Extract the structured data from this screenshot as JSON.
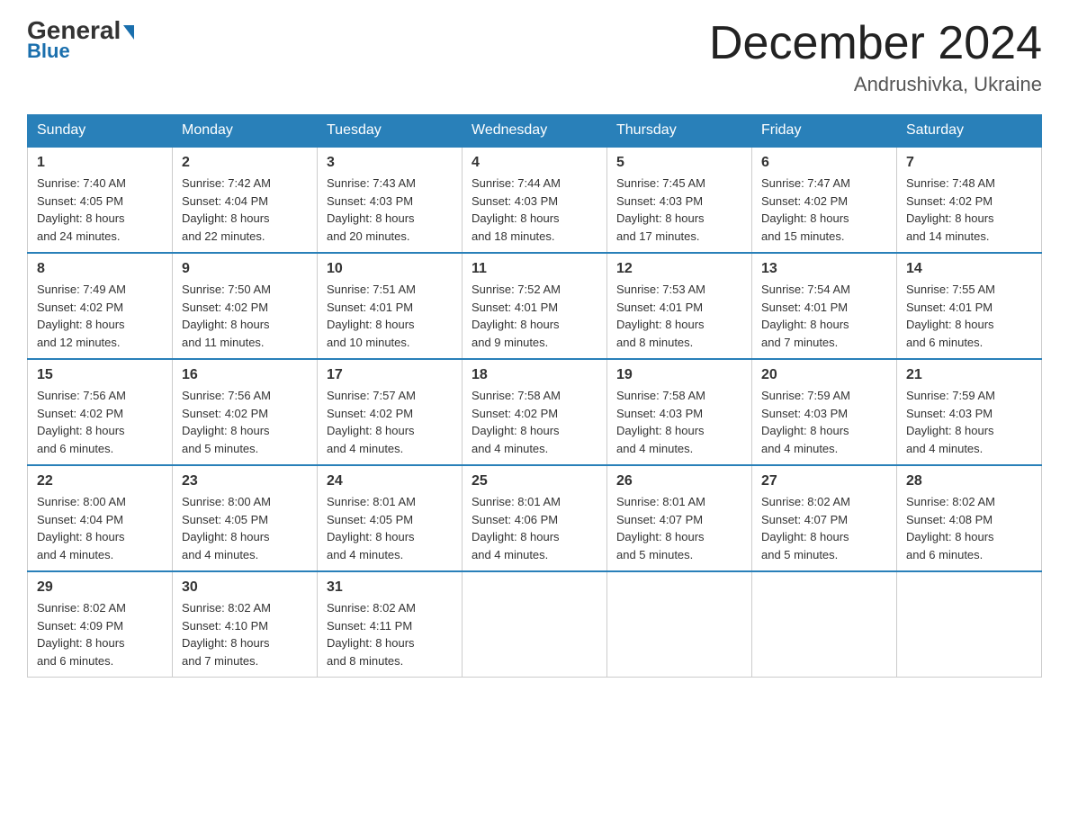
{
  "header": {
    "logo_general": "General",
    "logo_blue": "Blue",
    "month_title": "December 2024",
    "location": "Andrushivka, Ukraine"
  },
  "days_of_week": [
    "Sunday",
    "Monday",
    "Tuesday",
    "Wednesday",
    "Thursday",
    "Friday",
    "Saturday"
  ],
  "weeks": [
    [
      {
        "num": "1",
        "sunrise": "7:40 AM",
        "sunset": "4:05 PM",
        "daylight": "8 hours and 24 minutes."
      },
      {
        "num": "2",
        "sunrise": "7:42 AM",
        "sunset": "4:04 PM",
        "daylight": "8 hours and 22 minutes."
      },
      {
        "num": "3",
        "sunrise": "7:43 AM",
        "sunset": "4:03 PM",
        "daylight": "8 hours and 20 minutes."
      },
      {
        "num": "4",
        "sunrise": "7:44 AM",
        "sunset": "4:03 PM",
        "daylight": "8 hours and 18 minutes."
      },
      {
        "num": "5",
        "sunrise": "7:45 AM",
        "sunset": "4:03 PM",
        "daylight": "8 hours and 17 minutes."
      },
      {
        "num": "6",
        "sunrise": "7:47 AM",
        "sunset": "4:02 PM",
        "daylight": "8 hours and 15 minutes."
      },
      {
        "num": "7",
        "sunrise": "7:48 AM",
        "sunset": "4:02 PM",
        "daylight": "8 hours and 14 minutes."
      }
    ],
    [
      {
        "num": "8",
        "sunrise": "7:49 AM",
        "sunset": "4:02 PM",
        "daylight": "8 hours and 12 minutes."
      },
      {
        "num": "9",
        "sunrise": "7:50 AM",
        "sunset": "4:02 PM",
        "daylight": "8 hours and 11 minutes."
      },
      {
        "num": "10",
        "sunrise": "7:51 AM",
        "sunset": "4:01 PM",
        "daylight": "8 hours and 10 minutes."
      },
      {
        "num": "11",
        "sunrise": "7:52 AM",
        "sunset": "4:01 PM",
        "daylight": "8 hours and 9 minutes."
      },
      {
        "num": "12",
        "sunrise": "7:53 AM",
        "sunset": "4:01 PM",
        "daylight": "8 hours and 8 minutes."
      },
      {
        "num": "13",
        "sunrise": "7:54 AM",
        "sunset": "4:01 PM",
        "daylight": "8 hours and 7 minutes."
      },
      {
        "num": "14",
        "sunrise": "7:55 AM",
        "sunset": "4:01 PM",
        "daylight": "8 hours and 6 minutes."
      }
    ],
    [
      {
        "num": "15",
        "sunrise": "7:56 AM",
        "sunset": "4:02 PM",
        "daylight": "8 hours and 6 minutes."
      },
      {
        "num": "16",
        "sunrise": "7:56 AM",
        "sunset": "4:02 PM",
        "daylight": "8 hours and 5 minutes."
      },
      {
        "num": "17",
        "sunrise": "7:57 AM",
        "sunset": "4:02 PM",
        "daylight": "8 hours and 4 minutes."
      },
      {
        "num": "18",
        "sunrise": "7:58 AM",
        "sunset": "4:02 PM",
        "daylight": "8 hours and 4 minutes."
      },
      {
        "num": "19",
        "sunrise": "7:58 AM",
        "sunset": "4:03 PM",
        "daylight": "8 hours and 4 minutes."
      },
      {
        "num": "20",
        "sunrise": "7:59 AM",
        "sunset": "4:03 PM",
        "daylight": "8 hours and 4 minutes."
      },
      {
        "num": "21",
        "sunrise": "7:59 AM",
        "sunset": "4:03 PM",
        "daylight": "8 hours and 4 minutes."
      }
    ],
    [
      {
        "num": "22",
        "sunrise": "8:00 AM",
        "sunset": "4:04 PM",
        "daylight": "8 hours and 4 minutes."
      },
      {
        "num": "23",
        "sunrise": "8:00 AM",
        "sunset": "4:05 PM",
        "daylight": "8 hours and 4 minutes."
      },
      {
        "num": "24",
        "sunrise": "8:01 AM",
        "sunset": "4:05 PM",
        "daylight": "8 hours and 4 minutes."
      },
      {
        "num": "25",
        "sunrise": "8:01 AM",
        "sunset": "4:06 PM",
        "daylight": "8 hours and 4 minutes."
      },
      {
        "num": "26",
        "sunrise": "8:01 AM",
        "sunset": "4:07 PM",
        "daylight": "8 hours and 5 minutes."
      },
      {
        "num": "27",
        "sunrise": "8:02 AM",
        "sunset": "4:07 PM",
        "daylight": "8 hours and 5 minutes."
      },
      {
        "num": "28",
        "sunrise": "8:02 AM",
        "sunset": "4:08 PM",
        "daylight": "8 hours and 6 minutes."
      }
    ],
    [
      {
        "num": "29",
        "sunrise": "8:02 AM",
        "sunset": "4:09 PM",
        "daylight": "8 hours and 6 minutes."
      },
      {
        "num": "30",
        "sunrise": "8:02 AM",
        "sunset": "4:10 PM",
        "daylight": "8 hours and 7 minutes."
      },
      {
        "num": "31",
        "sunrise": "8:02 AM",
        "sunset": "4:11 PM",
        "daylight": "8 hours and 8 minutes."
      },
      null,
      null,
      null,
      null
    ]
  ],
  "labels": {
    "sunrise": "Sunrise:",
    "sunset": "Sunset:",
    "daylight": "Daylight:"
  }
}
